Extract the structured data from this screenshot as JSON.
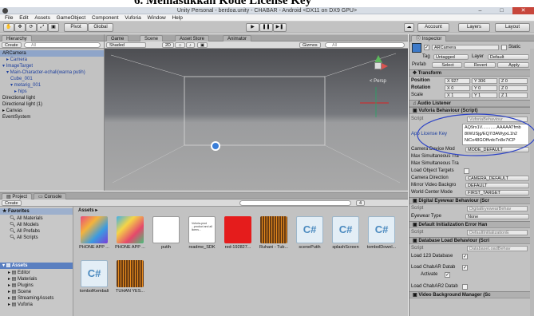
{
  "caption": "6.   Memasukkan Kode License Key",
  "window": {
    "title": "Unity Personal - berdoa.unity - CHABAR - Android <DX11 on DX9 GPU>",
    "minimize": "–",
    "maximize": "□",
    "close": "✕"
  },
  "menu": [
    "File",
    "Edit",
    "Assets",
    "GameObject",
    "Component",
    "Vuforia",
    "Window",
    "Help"
  ],
  "toolbar": {
    "pivot": "Pivot",
    "global": "Global",
    "play": "▶",
    "pause": "❚❚",
    "step": "▶❚",
    "account": "Account",
    "layers": "Layers",
    "layout": "Layout"
  },
  "hierarchy": {
    "tab": "Hierarchy",
    "create": "Create",
    "search": "All",
    "items": [
      {
        "label": "ARCamera",
        "indent": 0,
        "selected": true,
        "blue": false
      },
      {
        "label": "▸ Camera",
        "indent": 1,
        "selected": false,
        "blue": true
      },
      {
        "label": "▾ ImageTarget",
        "indent": 0,
        "selected": false,
        "blue": true
      },
      {
        "label": "▾ Main-Character-echali(warna putih)",
        "indent": 1,
        "selected": false,
        "blue": true
      },
      {
        "label": "Cube_001",
        "indent": 2,
        "selected": false,
        "blue": true
      },
      {
        "label": "▾ metarig_001",
        "indent": 2,
        "selected": false,
        "blue": true
      },
      {
        "label": "▸ hips",
        "indent": 3,
        "selected": false,
        "blue": true
      },
      {
        "label": "Directional light",
        "indent": 0,
        "selected": false,
        "blue": false
      },
      {
        "label": "Directional light (1)",
        "indent": 0,
        "selected": false,
        "blue": false
      },
      {
        "label": "▸ Canvas",
        "indent": 0,
        "selected": false,
        "blue": false
      },
      {
        "label": "EventSystem",
        "indent": 0,
        "selected": false,
        "blue": false
      }
    ]
  },
  "scene": {
    "tabs": [
      "Game",
      "Scene",
      "Asset Store",
      "Animator"
    ],
    "shaded": "Shaded",
    "mode2d": "2D",
    "gizmos": "Gizmos",
    "search": "All",
    "persp": "< Persp"
  },
  "project": {
    "tabs": [
      "Project",
      "Console"
    ],
    "create": "Create",
    "favorites": "Favorites",
    "fav_items": [
      "All Materials",
      "All Models",
      "All Prefabs",
      "All Scripts"
    ],
    "assets_root": "Assets",
    "tree": [
      "Editor",
      "Materials",
      "Plugins",
      "Scene",
      "StreamingAssets",
      "Vuforia"
    ],
    "breadcrumb": "Assets ▸",
    "count": "4",
    "assets": [
      {
        "label": "PHONE APP ...",
        "kind": "img1"
      },
      {
        "label": "PHONE APP ...",
        "kind": "img2"
      },
      {
        "label": "putih",
        "kind": "white"
      },
      {
        "label": "readme_SDK",
        "kind": "doc"
      },
      {
        "label": "red-192827...",
        "kind": "red"
      },
      {
        "label": "Ruhani - Tub...",
        "kind": "audio"
      },
      {
        "label": "scenePutih",
        "kind": "cs"
      },
      {
        "label": "splashScreen",
        "kind": "cs"
      },
      {
        "label": "tombolDownl...",
        "kind": "cs"
      },
      {
        "label": "tombolKembali",
        "kind": "cs"
      },
      {
        "label": "TUHAN YES...",
        "kind": "audio2"
      }
    ],
    "doc_text": "Vuforia-prod ...product and all licens..."
  },
  "inspector": {
    "tab": "Inspector",
    "object_name": "ARCamera",
    "static": "Static",
    "tag_label": "Tag",
    "tag": "Untagged",
    "layer_label": "Layer",
    "layer": "Default",
    "prefab": "Prefab",
    "select": "Select",
    "revert": "Revert",
    "apply": "Apply",
    "transform": "Transform",
    "position": {
      "label": "Position",
      "x": "X  927",
      "y": "Y  306",
      "z": "Z  0"
    },
    "rotation": {
      "label": "Rotation",
      "x": "X  0",
      "y": "Y  0",
      "z": "Z  0"
    },
    "scale": {
      "label": "Scale",
      "x": "X  1",
      "y": "Y  1",
      "z": "Z  1"
    },
    "audio_listener": "Audio Listener",
    "vuforia_behaviour": "Vuforia Behaviour (Script)",
    "script_label": "Script",
    "script_value": "VuforiaBehaviour",
    "app_license_key": "App License Key",
    "license_lines": [
      "AQ9rx1V............AAAAATfmb",
      "8iWUSjg/EQ7/3AWyjxL1h2",
      "NiCo48GOffvdoTn8e7tCP"
    ],
    "camera_device_mode_label": "Camera Device Mod",
    "camera_device_mode": "MODE_DEFAULT",
    "max_sim_1": "Max Simultaneous Tra",
    "max_sim_2": "Max Simultaneous Tra",
    "load_object_targets": "Load Object Targets",
    "camera_direction_label": "Camera Direction",
    "camera_direction": "CAMERA_DEFAULT",
    "mirror_label": "Mirror Video Backgro",
    "mirror": "DEFAULT",
    "world_center_label": "World Center Mode",
    "world_center": "FIRST_TARGET",
    "digital_eyewear": "Digital Eyewear Behaviour (Scr",
    "digital_eyewear_script": "DigitalEyewearBehav",
    "eyewear_type_label": "Eyewear Type",
    "eyewear_type": "None",
    "default_init": "Default Initialization Error Han",
    "default_init_script": "DefaultInitializationE",
    "database_load": "Database Load Behaviour (Scri",
    "database_load_script": "DatabaseLoadBehav",
    "load_123": "Load 123 Database",
    "load_chabar": "Load ChabAR Datab",
    "activate": "Activate",
    "load_chabar2": "Load ChabAR2 Datab",
    "video_bg": "Video Background Manager (Sc"
  },
  "colors": {
    "accent_blue": "#1d3f9e",
    "annotation": "#2e44c6",
    "selection": "#8fa5c9"
  }
}
